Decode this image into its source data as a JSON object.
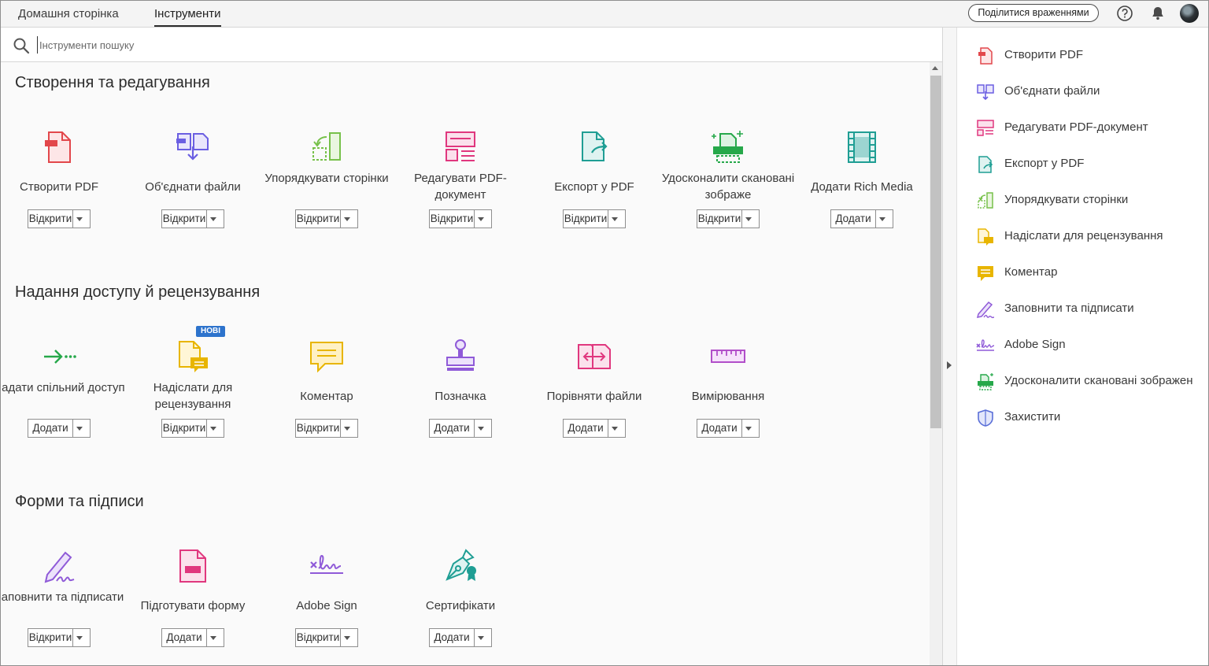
{
  "tabs": {
    "home": "Домашня сторінка",
    "tools": "Інструменти"
  },
  "share_label": "Поділитися враженнями",
  "search": {
    "placeholder": "Інструменти пошуку"
  },
  "sections": {
    "create": {
      "title": "Створення та редагування",
      "tools": [
        {
          "name": "Створити PDF",
          "button": "Відкрити"
        },
        {
          "name": "Об'єднати файли",
          "button": "Відкрити"
        },
        {
          "name": "Упорядкувати сторінки",
          "button": "Відкрити"
        },
        {
          "name": "Редагувати PDF-документ",
          "button": "Відкрити"
        },
        {
          "name": "Експорт у PDF",
          "button": "Відкрити"
        },
        {
          "name": "Удосконалити скановані зображе",
          "button": "Відкрити"
        },
        {
          "name": "Додати Rich Media",
          "button": "Додати"
        }
      ]
    },
    "share": {
      "title": "Надання доступу й рецензування",
      "badge": "НОВІ",
      "tools": [
        {
          "name": "Надати спільний доступ",
          "button": "Додати"
        },
        {
          "name": "Надіслати для рецензування",
          "button": "Відкрити"
        },
        {
          "name": "Коментар",
          "button": "Відкрити"
        },
        {
          "name": "Позначка",
          "button": "Додати"
        },
        {
          "name": "Порівняти файли",
          "button": "Додати"
        },
        {
          "name": "Вимірювання",
          "button": "Додати"
        }
      ]
    },
    "forms": {
      "title": "Форми та підписи",
      "tools": [
        {
          "name": "Заповнити та підписати",
          "button": "Відкрити"
        },
        {
          "name": "Підготувати форму",
          "button": "Додати"
        },
        {
          "name": "Adobe Sign",
          "button": "Відкрити"
        },
        {
          "name": "Сертифікати",
          "button": "Додати"
        }
      ]
    }
  },
  "right_pane": [
    {
      "label": "Створити PDF",
      "icon": "create-pdf-icon"
    },
    {
      "label": "Об'єднати файли",
      "icon": "combine-files-icon"
    },
    {
      "label": "Редагувати PDF-документ",
      "icon": "edit-pdf-icon"
    },
    {
      "label": "Експорт у PDF",
      "icon": "export-pdf-icon"
    },
    {
      "label": "Упорядкувати сторінки",
      "icon": "organize-pages-icon"
    },
    {
      "label": "Надіслати для рецензування",
      "icon": "send-for-review-icon"
    },
    {
      "label": "Коментар",
      "icon": "comment-icon"
    },
    {
      "label": "Заповнити та підписати",
      "icon": "fill-sign-icon"
    },
    {
      "label": "Adobe Sign",
      "icon": "adobe-sign-icon"
    },
    {
      "label": "Удосконалити скановані зображен",
      "icon": "enhance-scans-icon"
    },
    {
      "label": "Захистити",
      "icon": "protect-icon"
    }
  ],
  "colors": {
    "create_pdf": "#e2474b",
    "combine": "#6b5fe2",
    "organize": "#77c14a",
    "edit_pdf": "#e0377e",
    "export": "#1f9e94",
    "enhance": "#26a84a",
    "rich_media": "#1f9e94",
    "share": "#26a84a",
    "review": "#e8b500",
    "comment": "#e8b500",
    "stamp": "#8f5ad8",
    "compare": "#e0377e",
    "measure": "#b14ec9",
    "fill_sign": "#8f5ad8",
    "prepare_form": "#e0377e",
    "adobe_sign": "#8f5ad8",
    "certificates": "#1f9e94",
    "protect": "#5a6fd8",
    "badge": "#2d73cc"
  }
}
